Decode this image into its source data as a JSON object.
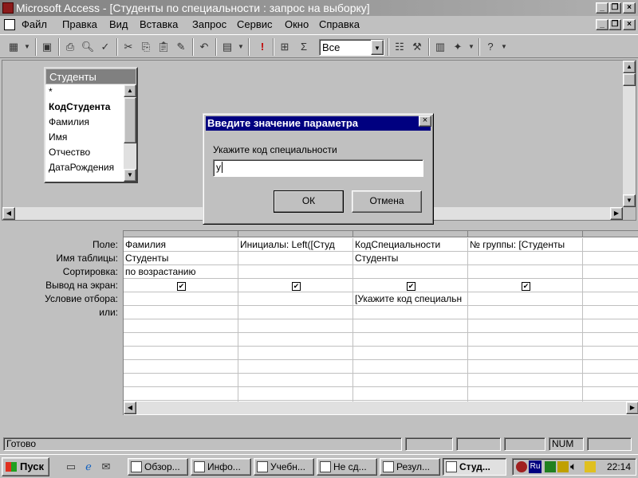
{
  "window": {
    "title": "Microsoft Access - [Студенты по специальности : запрос на выборку]"
  },
  "menu": {
    "items": [
      "Файл",
      "Правка",
      "Вид",
      "Вставка",
      "Запрос",
      "Сервис",
      "Окно",
      "Справка"
    ]
  },
  "toolbar": {
    "top_values": "Все"
  },
  "table_box": {
    "title": "Студенты",
    "fields": [
      "*",
      "КодСтудента",
      "Фамилия",
      "Имя",
      "Отчество",
      "ДатаРождения"
    ]
  },
  "dialog": {
    "title": "Введите значение параметра",
    "prompt": "Укажите код специальности",
    "value": "у",
    "ok_label": "ОК",
    "cancel_label": "Отмена"
  },
  "grid": {
    "row_labels": [
      "Поле:",
      "Имя таблицы:",
      "Сортировка:",
      "Вывод на экран:",
      "Условие отбора:",
      "или:"
    ],
    "columns": [
      {
        "field": "Фамилия",
        "table": "Студенты",
        "sort": "по возрастанию",
        "show": true,
        "criteria": ""
      },
      {
        "field": "Инициалы: Left([Студ",
        "table": "",
        "sort": "",
        "show": true,
        "criteria": ""
      },
      {
        "field": "КодСпециальности",
        "table": "Студенты",
        "sort": "",
        "show": true,
        "criteria": "[Укажите код специальн"
      },
      {
        "field": "№ группы: [Студенты",
        "table": "",
        "sort": "",
        "show": true,
        "criteria": ""
      },
      {
        "field": "",
        "table": "",
        "sort": "",
        "show": false,
        "criteria": ""
      }
    ]
  },
  "status": {
    "text": "Готово",
    "num": "NUM"
  },
  "taskbar": {
    "start_label": "Пуск",
    "tasks": [
      "Обзор...",
      "Инфо...",
      "Учебн...",
      "Не сд...",
      "Резул...",
      "Студ..."
    ],
    "clock": "22:14",
    "lang": "Ru"
  }
}
